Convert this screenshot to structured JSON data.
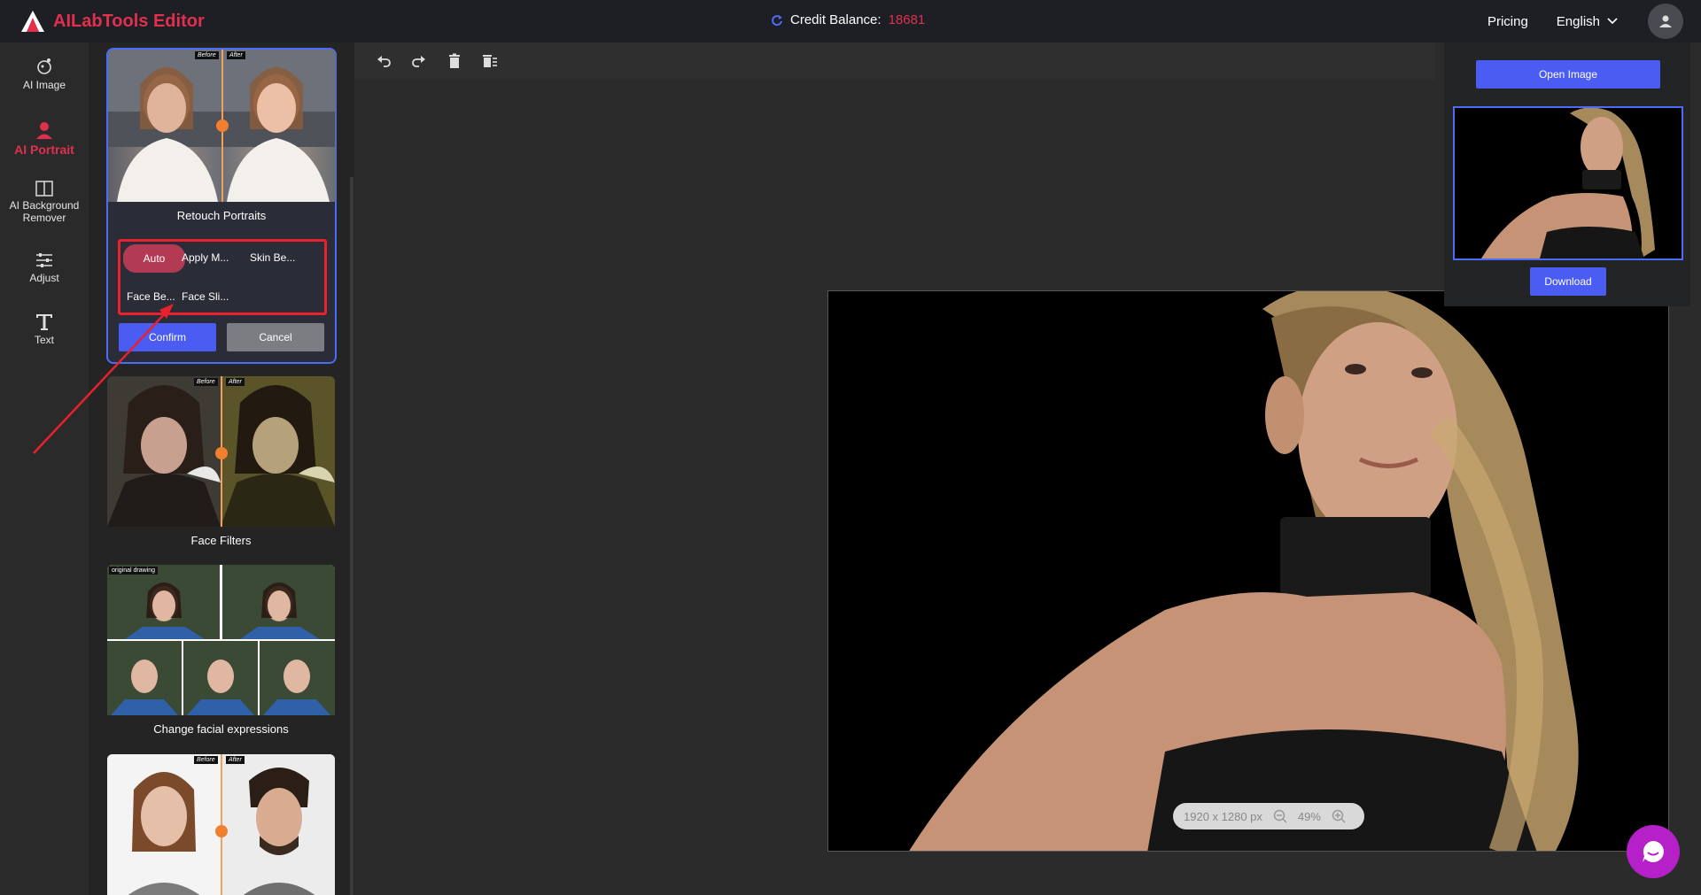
{
  "app": {
    "title": "AILabTools Editor"
  },
  "header": {
    "credit_label": "Credit Balance:",
    "credit_value": "18681",
    "pricing": "Pricing",
    "language": "English"
  },
  "rail": [
    {
      "label": "AI Image",
      "icon": "ai-image-icon"
    },
    {
      "label": "AI Portrait",
      "icon": "portrait-icon",
      "active": true
    },
    {
      "label": "AI Background Remover",
      "icon": "background-remover-icon"
    },
    {
      "label": "Adjust",
      "icon": "sliders-icon"
    },
    {
      "label": "Text",
      "icon": "text-icon"
    }
  ],
  "panel": {
    "cards": [
      {
        "title": "Retouch Portraits"
      },
      {
        "title": "Face Filters"
      },
      {
        "title": "Change facial expressions"
      }
    ],
    "before_label": "Before",
    "after_label": "After",
    "original_label": "original drawing",
    "options": [
      "Auto",
      "Apply M...",
      "Skin Be...",
      "Face Be...",
      "Face Sli..."
    ],
    "selected_option": "Auto",
    "confirm": "Confirm",
    "cancel": "Cancel"
  },
  "canvas": {
    "dimensions": "1920 x 1280 px",
    "zoom": "49%"
  },
  "right_panel": {
    "open_image": "Open Image",
    "download": "Download"
  },
  "colors": {
    "brand": "#e0304e",
    "primary": "#4a5cf2",
    "highlight_box": "#e8212c"
  }
}
